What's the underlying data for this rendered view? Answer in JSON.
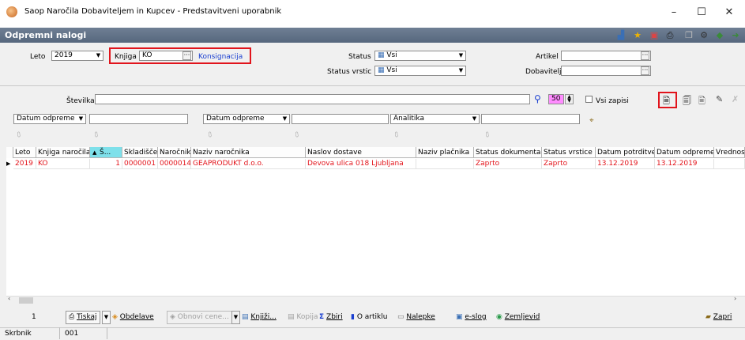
{
  "window": {
    "title": "Saop  Naročila Dobaviteljem in Kupcev - Predstavitveni uporabnik"
  },
  "header": {
    "title": "Odpremni nalogi"
  },
  "filters": {
    "leto_label": "Leto",
    "leto_value": "2019",
    "knjiga_label": "Knjiga",
    "knjiga_value": "KO",
    "knjiga_name": "Konsignacija",
    "status_label": "Status",
    "status_value": "Vsi",
    "status_vrstic_label": "Status vrstic",
    "status_vrstic_value": "Vsi",
    "artikel_label": "Artikel",
    "dobavitelj_label": "Dobavitelj",
    "stevilka_label": "Številka",
    "count_value": "50",
    "vsi_zapisi_label": "Vsi zapisi",
    "sort1": "Datum odpreme",
    "sort2": "Datum odpreme",
    "sort3": "Analitika"
  },
  "table": {
    "columns": [
      "Leto",
      "Knjiga naročila",
      "Š...",
      "Skladišče",
      "Naročnik",
      "Naziv naročnika",
      "Naslov dostave",
      "Naziv plačnika",
      "Status dokumenta",
      "Status vrstice",
      "Datum potrditve",
      "Datum odpreme",
      "Vrednost"
    ],
    "rows": [
      [
        "2019",
        "KO",
        "1",
        "0000001",
        "0000014",
        "GEAPRODUKT d.o.o.",
        "Devova ulica 018 Ljubljana",
        "",
        "Zaprto",
        "Zaprto",
        "13.12.2019",
        "13.12.2019",
        ""
      ]
    ]
  },
  "toolbar": {
    "page": "1",
    "tiskaj": "Tiskaj",
    "obdelave": "Obdelave",
    "obnovi": "Obnovi cene...",
    "knjizi": "Knjiži...",
    "kopija": "Kopija",
    "zbiri": "Zbiri",
    "o_artiklu": "O artiklu",
    "nalepke": "Nalepke",
    "eslog": "e-slog",
    "zemljevid": "Zemljevid",
    "zapri": "Zapri"
  },
  "statusbar": {
    "label": "Skrbnik",
    "value": "001"
  },
  "colors": {
    "header": "#5f7088",
    "accent_red": "#e1141c",
    "row_text": "#e3141b"
  }
}
